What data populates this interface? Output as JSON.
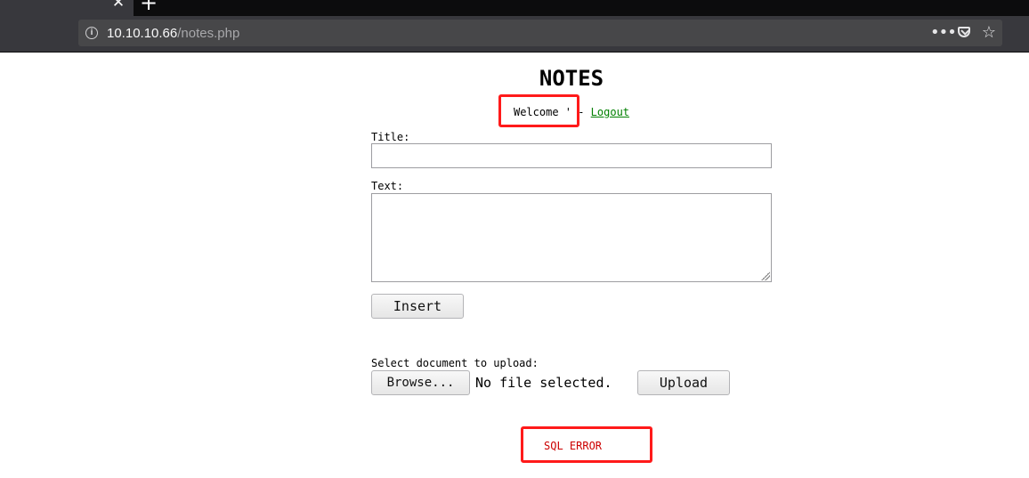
{
  "browser": {
    "url_host": "10.10.10.66",
    "url_path": "/notes.php",
    "icons": {
      "tab_close": "✕",
      "new_tab": "+",
      "info": "i",
      "more": "•••",
      "pocket": "pocket-icon",
      "bookmark": "☆"
    }
  },
  "page": {
    "title": "NOTES",
    "welcome_text": "Welcome ' - ",
    "logout_label": "Logout",
    "title_label": "Title:",
    "title_value": "",
    "text_label": "Text:",
    "text_value": "",
    "insert_label": "Insert",
    "upload_prompt": "Select document to upload:",
    "browse_label": "Browse...",
    "no_file_text": "No file selected.",
    "upload_label": "Upload",
    "sql_error": "SQL ERROR"
  },
  "colors": {
    "link": "#008000",
    "error": "#cc0000",
    "highlight": "#ff1a1a"
  }
}
